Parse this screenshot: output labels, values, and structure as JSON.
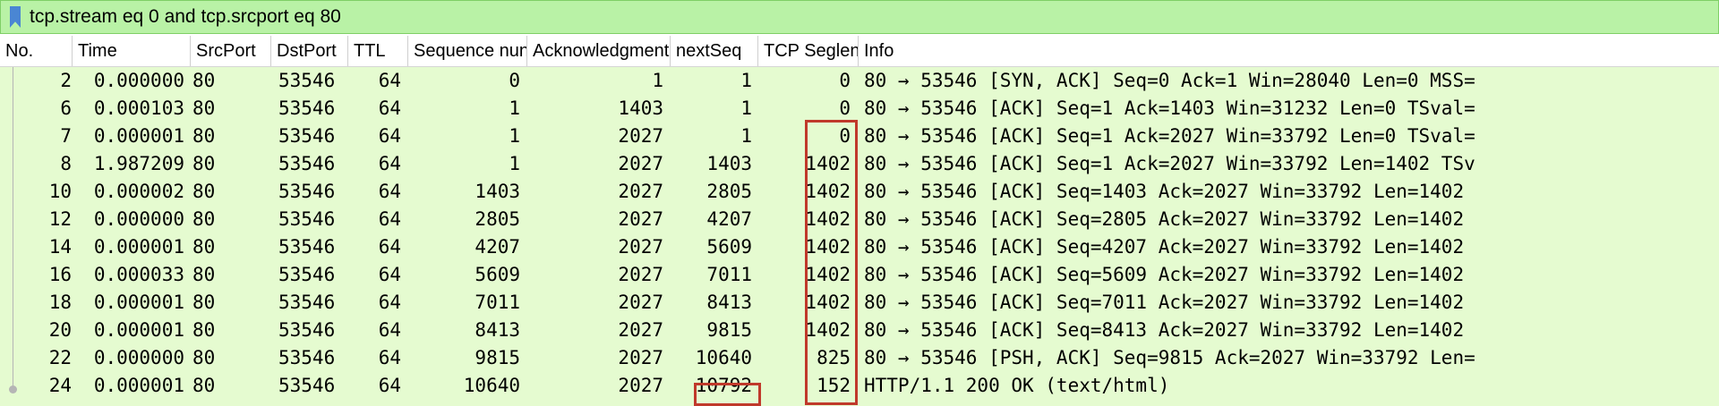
{
  "filter": {
    "value": "tcp.stream eq 0 and tcp.srcport eq 80",
    "icon": "bookmark-icon",
    "color": "#b9f2a6"
  },
  "columns": [
    "No.",
    "Time",
    "SrcPort",
    "DstPort",
    "TTL",
    "Sequence nun",
    "Acknowledgment",
    "nextSeq",
    "TCP Seglen",
    "Info"
  ],
  "rows": [
    {
      "no": "2",
      "time": "0.000000",
      "src": "80",
      "dst": "53546",
      "ttl": "64",
      "seq": "0",
      "ack": "1",
      "next": "1",
      "seglen": "0",
      "info": "80 → 53546 [SYN, ACK] Seq=0 Ack=1 Win=28040 Len=0 MSS="
    },
    {
      "no": "6",
      "time": "0.000103",
      "src": "80",
      "dst": "53546",
      "ttl": "64",
      "seq": "1",
      "ack": "1403",
      "next": "1",
      "seglen": "0",
      "info": "80 → 53546 [ACK] Seq=1 Ack=1403 Win=31232 Len=0 TSval="
    },
    {
      "no": "7",
      "time": "0.000001",
      "src": "80",
      "dst": "53546",
      "ttl": "64",
      "seq": "1",
      "ack": "2027",
      "next": "1",
      "seglen": "0",
      "info": "80 → 53546 [ACK] Seq=1 Ack=2027 Win=33792 Len=0 TSval="
    },
    {
      "no": "8",
      "time": "1.987209",
      "src": "80",
      "dst": "53546",
      "ttl": "64",
      "seq": "1",
      "ack": "2027",
      "next": "1403",
      "seglen": "1402",
      "info": "80 → 53546 [ACK] Seq=1 Ack=2027 Win=33792 Len=1402 TSv"
    },
    {
      "no": "10",
      "time": "0.000002",
      "src": "80",
      "dst": "53546",
      "ttl": "64",
      "seq": "1403",
      "ack": "2027",
      "next": "2805",
      "seglen": "1402",
      "info": "80 → 53546 [ACK] Seq=1403 Ack=2027 Win=33792 Len=1402"
    },
    {
      "no": "12",
      "time": "0.000000",
      "src": "80",
      "dst": "53546",
      "ttl": "64",
      "seq": "2805",
      "ack": "2027",
      "next": "4207",
      "seglen": "1402",
      "info": "80 → 53546 [ACK] Seq=2805 Ack=2027 Win=33792 Len=1402"
    },
    {
      "no": "14",
      "time": "0.000001",
      "src": "80",
      "dst": "53546",
      "ttl": "64",
      "seq": "4207",
      "ack": "2027",
      "next": "5609",
      "seglen": "1402",
      "info": "80 → 53546 [ACK] Seq=4207 Ack=2027 Win=33792 Len=1402"
    },
    {
      "no": "16",
      "time": "0.000033",
      "src": "80",
      "dst": "53546",
      "ttl": "64",
      "seq": "5609",
      "ack": "2027",
      "next": "7011",
      "seglen": "1402",
      "info": "80 → 53546 [ACK] Seq=5609 Ack=2027 Win=33792 Len=1402"
    },
    {
      "no": "18",
      "time": "0.000001",
      "src": "80",
      "dst": "53546",
      "ttl": "64",
      "seq": "7011",
      "ack": "2027",
      "next": "8413",
      "seglen": "1402",
      "info": "80 → 53546 [ACK] Seq=7011 Ack=2027 Win=33792 Len=1402"
    },
    {
      "no": "20",
      "time": "0.000001",
      "src": "80",
      "dst": "53546",
      "ttl": "64",
      "seq": "8413",
      "ack": "2027",
      "next": "9815",
      "seglen": "1402",
      "info": "80 → 53546 [ACK] Seq=8413 Ack=2027 Win=33792 Len=1402"
    },
    {
      "no": "22",
      "time": "0.000000",
      "src": "80",
      "dst": "53546",
      "ttl": "64",
      "seq": "9815",
      "ack": "2027",
      "next": "10640",
      "seglen": "825",
      "info": "80 → 53546 [PSH, ACK] Seq=9815 Ack=2027 Win=33792 Len="
    },
    {
      "no": "24",
      "time": "0.000001",
      "src": "80",
      "dst": "53546",
      "ttl": "64",
      "seq": "10640",
      "ack": "2027",
      "next": "10792",
      "seglen": "152",
      "info": "HTTP/1.1 200 OK  (text/html)"
    }
  ],
  "colors": {
    "row_bg": "#e5fbd0",
    "highlight": "#c0392b"
  }
}
